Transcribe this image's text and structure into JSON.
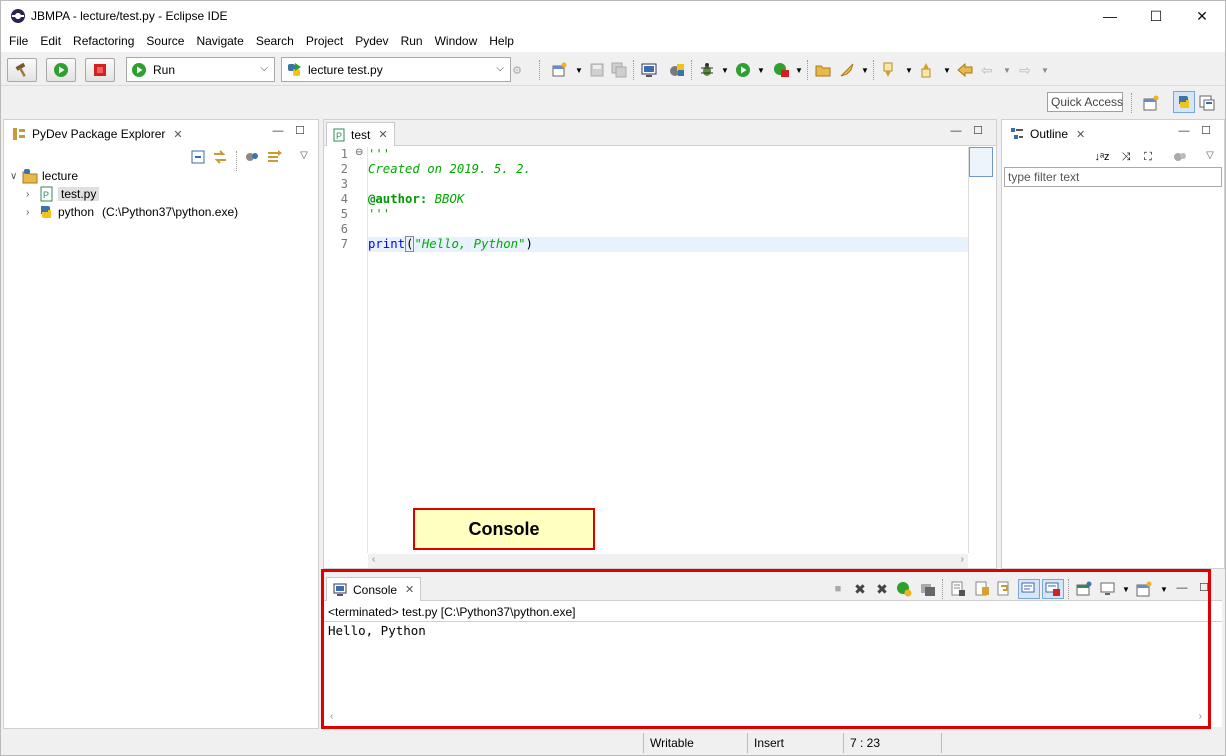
{
  "window": {
    "title": "JBMPA - lecture/test.py - Eclipse IDE",
    "controls": {
      "minimize": "—",
      "maximize": "☐",
      "close": "✕"
    }
  },
  "menu": [
    "File",
    "Edit",
    "Refactoring",
    "Source",
    "Navigate",
    "Search",
    "Project",
    "Pydev",
    "Run",
    "Window",
    "Help"
  ],
  "toolbar": {
    "run_config": "Run",
    "launch_target": "lecture test.py"
  },
  "quick_access": "Quick Access",
  "package_explorer": {
    "tab_label": "PyDev Package Explorer",
    "project": "lecture",
    "file": "test.py",
    "interpreter": "python",
    "interpreter_path": "(C:\\Python37\\python.exe)"
  },
  "editor": {
    "tab_label": "test",
    "lines": [
      {
        "num": "1",
        "text": "'''"
      },
      {
        "num": "2",
        "text": "Created on 2019. 5. 2."
      },
      {
        "num": "3",
        "text": ""
      },
      {
        "num": "4",
        "text_a": "@author:",
        "text_b": " BBOK"
      },
      {
        "num": "5",
        "text": "'''"
      },
      {
        "num": "6",
        "text": ""
      },
      {
        "num": "7",
        "text_a": "print",
        "text_b": "(",
        "text_c": "\"Hello, Python\"",
        "text_d": ")"
      }
    ]
  },
  "outline": {
    "tab_label": "Outline",
    "filter_placeholder": "type filter text"
  },
  "annotation": {
    "label": "Console"
  },
  "console": {
    "tab_label": "Console",
    "status": "<terminated> test.py [C:\\Python37\\python.exe]",
    "output": "Hello, Python"
  },
  "status_bar": {
    "mode": "Writable",
    "insert": "Insert",
    "position": "7 : 23"
  },
  "colors": {
    "highlight_red": "#e00000",
    "annotation_bg": "#ffffc0",
    "comment_green": "#00aa00",
    "keyword_blue": "#0000ff"
  }
}
